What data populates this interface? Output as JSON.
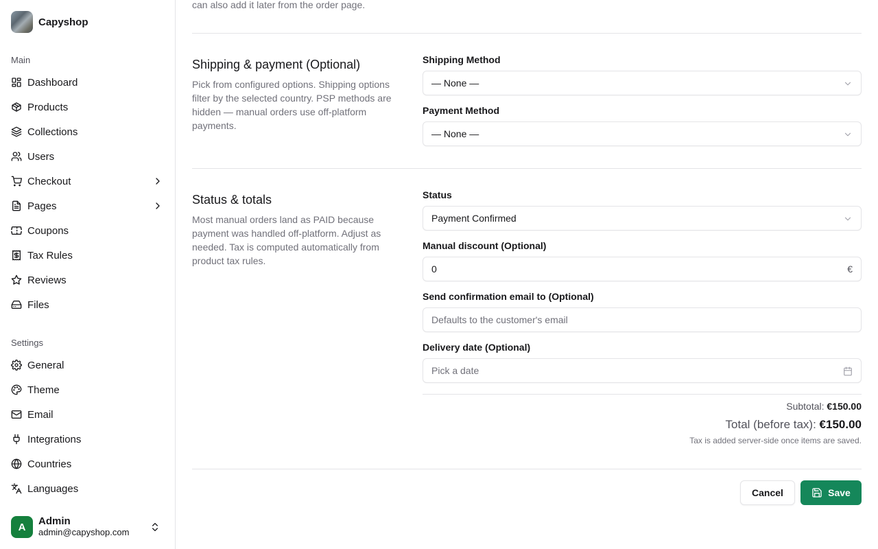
{
  "app": {
    "name": "Capyshop"
  },
  "sidebar": {
    "main_label": "Main",
    "main_items": [
      {
        "label": "Dashboard",
        "icon": "dashboard-icon"
      },
      {
        "label": "Products",
        "icon": "package-icon"
      },
      {
        "label": "Collections",
        "icon": "layers-icon"
      },
      {
        "label": "Users",
        "icon": "users-icon"
      },
      {
        "label": "Checkout",
        "icon": "cart-icon",
        "has_submenu": true
      },
      {
        "label": "Pages",
        "icon": "file-text-icon",
        "has_submenu": true
      },
      {
        "label": "Coupons",
        "icon": "ticket-icon"
      },
      {
        "label": "Tax Rules",
        "icon": "receipt-icon"
      },
      {
        "label": "Reviews",
        "icon": "star-icon"
      },
      {
        "label": "Files",
        "icon": "hard-drive-icon"
      }
    ],
    "settings_label": "Settings",
    "settings_items": [
      {
        "label": "General",
        "icon": "gear-icon"
      },
      {
        "label": "Theme",
        "icon": "palette-icon"
      },
      {
        "label": "Email",
        "icon": "mail-icon"
      },
      {
        "label": "Integrations",
        "icon": "plug-icon"
      },
      {
        "label": "Countries",
        "icon": "globe-icon"
      },
      {
        "label": "Languages",
        "icon": "languages-icon"
      }
    ],
    "user": {
      "initial": "A",
      "name": "Admin",
      "email": "admin@capyshop.com"
    }
  },
  "form": {
    "top_text": "can also add it later from the order page.",
    "shipping": {
      "title": "Shipping & payment (Optional)",
      "description": "Pick from configured options. Shipping options filter by the selected country. PSP methods are hidden — manual orders use off-platform payments.",
      "shipping_method_label": "Shipping Method",
      "shipping_method_value": "— None —",
      "payment_method_label": "Payment Method",
      "payment_method_value": "— None —"
    },
    "status": {
      "title": "Status & totals",
      "description": "Most manual orders land as PAID because payment was handled off-platform. Adjust as needed. Tax is computed automatically from product tax rules.",
      "status_label": "Status",
      "status_value": "Payment Confirmed",
      "discount_label": "Manual discount (Optional)",
      "discount_value": "0",
      "discount_suffix": "€",
      "email_label": "Send confirmation email to (Optional)",
      "email_placeholder": "Defaults to the customer's email",
      "delivery_label": "Delivery date (Optional)",
      "delivery_placeholder": "Pick a date"
    },
    "totals": {
      "subtotal_label": "Subtotal:",
      "subtotal_value": "€150.00",
      "total_label": "Total (before tax):",
      "total_value": "€150.00",
      "tax_note": "Tax is added server-side once items are saved."
    },
    "actions": {
      "cancel_label": "Cancel",
      "save_label": "Save"
    }
  },
  "colors": {
    "accent": "#15875a",
    "avatar": "#15803d",
    "border": "#e4e4e7",
    "muted_text": "#71717a"
  }
}
